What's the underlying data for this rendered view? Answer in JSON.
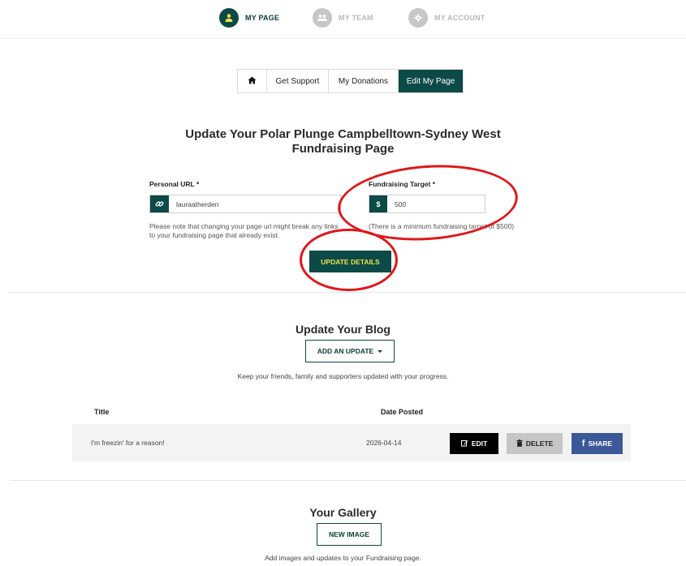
{
  "nav": {
    "items": [
      {
        "label": "MY PAGE",
        "icon": "user-icon"
      },
      {
        "label": "MY TEAM",
        "icon": "team-icon"
      },
      {
        "label": "MY ACCOUNT",
        "icon": "gear-icon"
      }
    ]
  },
  "tabs": {
    "home_icon": "home-icon",
    "items": [
      "Get Support",
      "My Donations",
      "Edit My Page"
    ],
    "active": "Edit My Page"
  },
  "page_title": "Update Your Polar Plunge Campbelltown-Sydney West Fundraising Page",
  "form": {
    "url_label": "Personal URL *",
    "url_value": "lauraatherden",
    "url_help": "Please note that changing your page url might break any links to your fundraising page that already exist.",
    "target_label": "Fundraising Target *",
    "target_addon": "$",
    "target_value": "500",
    "target_help": "(There is a minimum fundraising target of $500)",
    "update_button": "UPDATE DETAILS"
  },
  "blog": {
    "heading": "Update Your Blog",
    "add_button": "ADD AN UPDATE",
    "description": "Keep your friends, family and supporters updated with your progress.",
    "columns": [
      "Title",
      "Date Posted"
    ],
    "rows": [
      {
        "title": "I'm freezin' for a reason!",
        "date": "2026-04-14"
      }
    ],
    "edit_label": "EDIT",
    "delete_label": "DELETE",
    "share_label": "SHARE"
  },
  "gallery": {
    "heading": "Your Gallery",
    "new_button": "NEW IMAGE",
    "description": "Add images and updates to your Fundraising page."
  },
  "colors": {
    "primary": "#0b4a47",
    "button_text_accent": "#f2e24a",
    "annotation_red": "#e0171b",
    "facebook": "#3b5998"
  }
}
